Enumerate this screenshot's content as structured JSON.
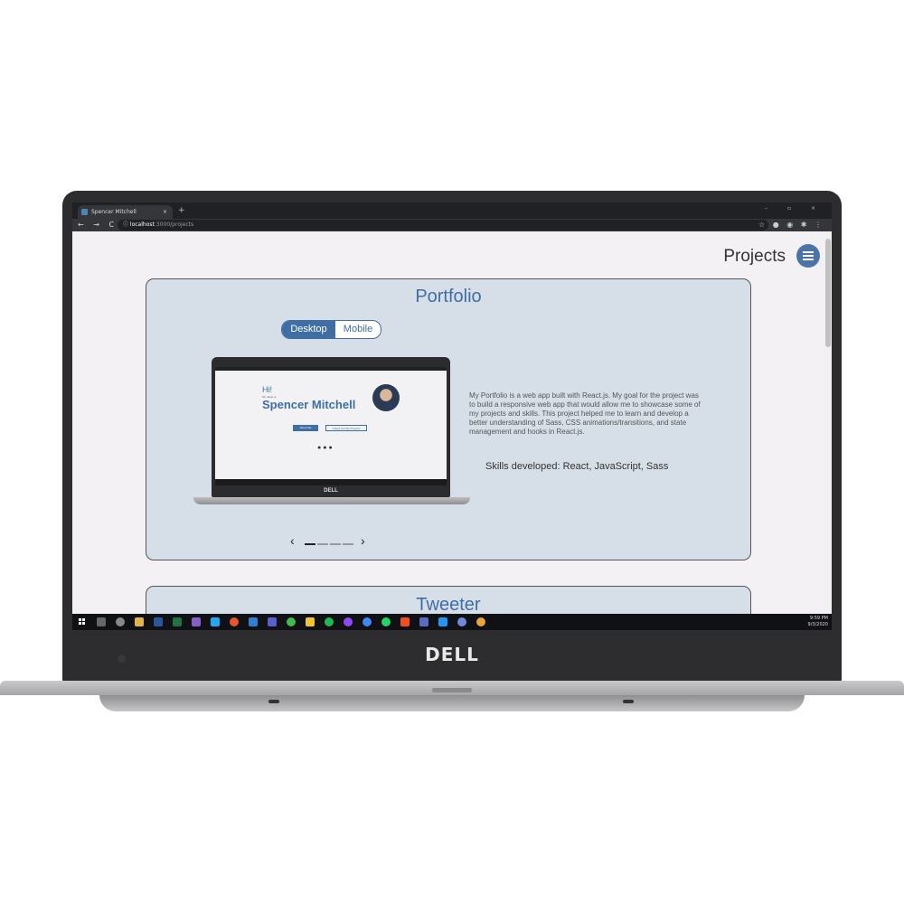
{
  "browser": {
    "tab_title": "Spencer Mitchell",
    "tab_close": "×",
    "new_tab": "+",
    "window_controls": "–  ▫  ×",
    "nav": "← → C",
    "url_host": "localhost",
    "url_path": ":3000/projects"
  },
  "page": {
    "title": "Projects"
  },
  "projects": [
    {
      "title": "Portfolio",
      "toggle": {
        "active": "Desktop",
        "inactive": "Mobile"
      },
      "preview": {
        "greeting": "Hi!",
        "subtitle": "My name is",
        "name": "Spencer Mitchell",
        "button_primary": "About Me",
        "button_secondary": "Check Out My Projects",
        "brand": "DELL"
      },
      "description": "My Portfolio is a web app built with React.js. My goal for the project was to build a responsive web app that would allow me to showcase some of my projects and skills. This project helped me to learn and develop a better understanding of Sass, CSS animations/transitions, and state management and hooks in React.js.",
      "skills": "Skills developed: React, JavaScript, Sass",
      "carousel": {
        "prev": "‹",
        "next": "›",
        "slides": 4,
        "current": 1
      }
    },
    {
      "title": "Tweeter"
    }
  ],
  "taskbar": {
    "time": "9:59 PM",
    "date": "9/3/2020"
  },
  "device": {
    "brand": "DELL"
  },
  "colors": {
    "accent": "#3f6ea5",
    "card_bg": "#d6dfe8",
    "page_bg": "#f3f1f4"
  }
}
